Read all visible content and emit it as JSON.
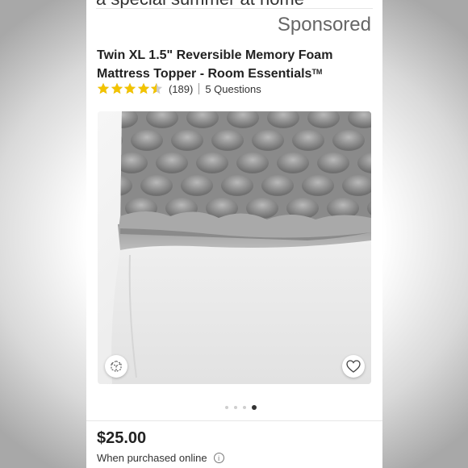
{
  "header": {
    "cut_text": "a special summer at home",
    "sponsored": "Sponsored"
  },
  "product": {
    "title": "Twin XL 1.5\" Reversible Memory Foam Mattress Topper - Room Essentials",
    "trademark": "TM",
    "rating": 4.5,
    "max_rating": 5,
    "review_count": "(189)",
    "questions": "5 Questions",
    "image_count": 4,
    "active_image": 4
  },
  "pricing": {
    "price": "$25.00",
    "note": "When purchased online",
    "info_icon": "i"
  },
  "colors": {
    "star": "#f2c300",
    "star_empty": "#cccccc",
    "text": "#222222"
  },
  "icons": {
    "three_d": "3d-view-icon",
    "favorite": "heart-icon",
    "info": "info-icon"
  }
}
